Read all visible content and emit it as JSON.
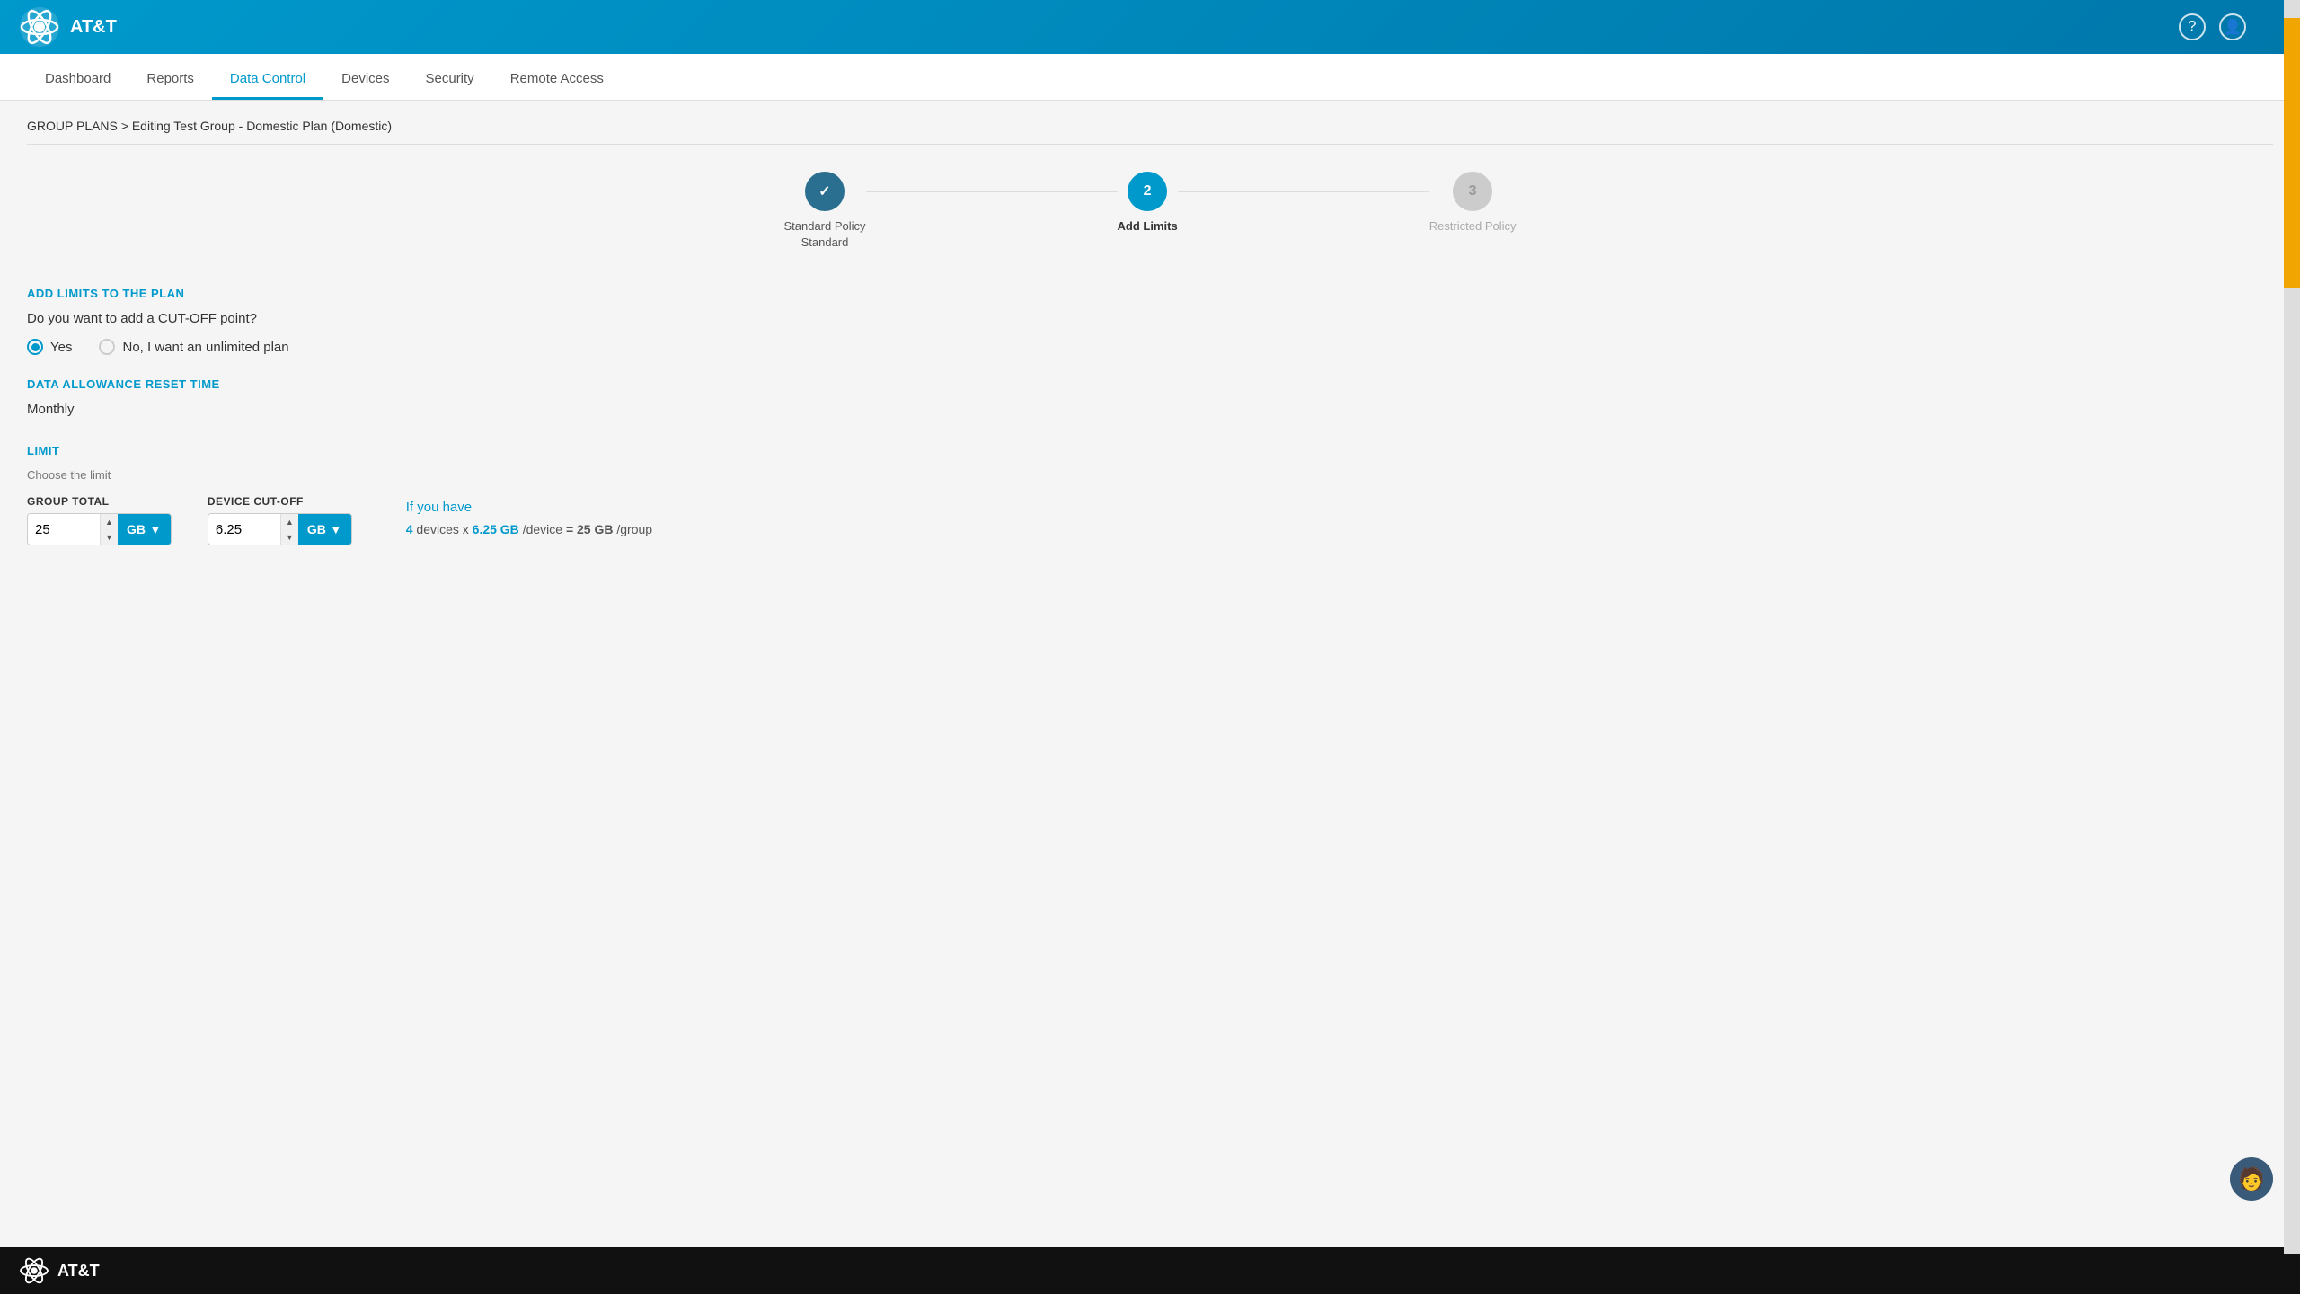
{
  "header": {
    "logo_alt": "AT&T Logo",
    "help_icon": "?",
    "user_icon": "👤"
  },
  "nav": {
    "items": [
      {
        "id": "dashboard",
        "label": "Dashboard",
        "active": false
      },
      {
        "id": "reports",
        "label": "Reports",
        "active": false
      },
      {
        "id": "data-control",
        "label": "Data Control",
        "active": true
      },
      {
        "id": "devices",
        "label": "Devices",
        "active": false
      },
      {
        "id": "security",
        "label": "Security",
        "active": false
      },
      {
        "id": "remote-access",
        "label": "Remote Access",
        "active": false
      }
    ]
  },
  "breadcrumb": {
    "text": "GROUP PLANS > Editing Test Group - Domestic Plan (Domestic)"
  },
  "stepper": {
    "steps": [
      {
        "id": "step1",
        "number": "✓",
        "state": "completed",
        "label_line1": "Standard Policy",
        "label_line2": "Standard"
      },
      {
        "id": "step2",
        "number": "2",
        "state": "active",
        "label_line1": "Add Limits",
        "label_line2": ""
      },
      {
        "id": "step3",
        "number": "3",
        "state": "inactive",
        "label_line1": "Restricted Policy",
        "label_line2": ""
      }
    ]
  },
  "form": {
    "add_limits_title": "ADD LIMITS TO THE PLAN",
    "cut_off_question": "Do you want to add a CUT-OFF point?",
    "radio_yes": "Yes",
    "radio_no": "No, I want an unlimited plan",
    "radio_selected": "yes",
    "reset_section_title": "DATA ALLOWANCE RESET TIME",
    "reset_value": "Monthly",
    "limit_section_title": "LIMIT",
    "limit_subtitle": "Choose the limit",
    "group_total_label": "GROUP TOTAL",
    "group_total_value": "25",
    "group_total_unit": "GB",
    "device_cutoff_label": "DEVICE CUT-OFF",
    "device_cutoff_value": "6.25",
    "device_cutoff_unit": "GB",
    "if_you_have_title": "If you have",
    "formula_devices": "4",
    "formula_per_device": "6.25 GB",
    "formula_unit_device": "/device",
    "formula_equals": "= 25 GB",
    "formula_unit_group": "/group"
  },
  "footer": {
    "logo_alt": "AT&T"
  },
  "colors": {
    "att_blue": "#0099cc",
    "dark_blue": "#2a6f8f",
    "inactive_gray": "#cccccc",
    "yellow_scrollbar": "#f0a500"
  }
}
